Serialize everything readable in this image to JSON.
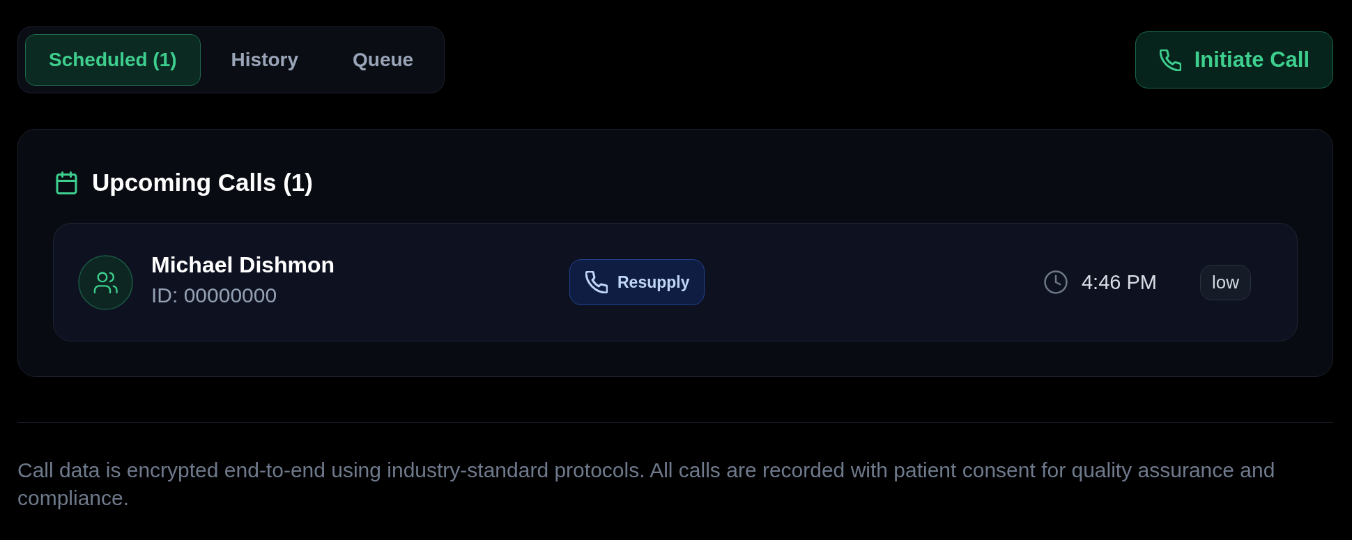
{
  "tabs": [
    {
      "label": "Scheduled (1)",
      "selected": true
    },
    {
      "label": "History",
      "selected": false
    },
    {
      "label": "Queue",
      "selected": false
    }
  ],
  "actions": {
    "initiate_call": "Initiate Call"
  },
  "upcoming": {
    "title": "Upcoming Calls (1)",
    "calls": [
      {
        "name": "Michael Dishmon",
        "patient_id": "ID: 00000000",
        "call_type": "Resupply",
        "time": "4:46 PM",
        "priority": "low"
      }
    ]
  },
  "footer": {
    "note": "Call data is encrypted end-to-end using industry-standard protocols. All calls are recorded with patient consent for quality assurance and compliance."
  }
}
